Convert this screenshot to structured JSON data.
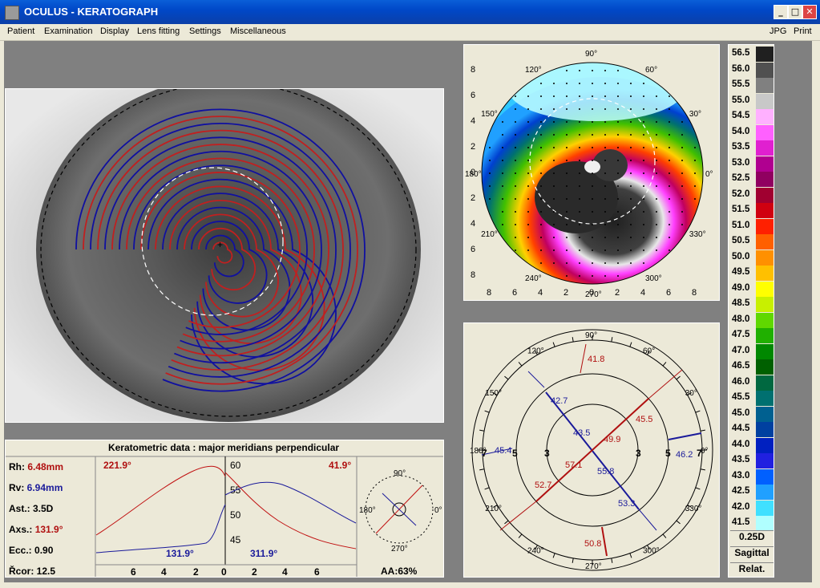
{
  "window": {
    "title": "OCULUS  -  KERATOGRAPH",
    "min": "_",
    "max": "□",
    "close": "✕"
  },
  "menu": {
    "items": [
      "Patient",
      "Examination",
      "Display",
      "Lens fitting",
      "Settings",
      "Miscellaneous"
    ],
    "right": [
      "JPG",
      "Print"
    ]
  },
  "topo_map": {
    "angle_labels": [
      "90°",
      "60°",
      "30°",
      "0°",
      "330°",
      "300°",
      "270°",
      "240°",
      "210°",
      "180°",
      "150°",
      "120°"
    ],
    "y_ticks": [
      "8",
      "6",
      "4",
      "2",
      "0",
      "2",
      "4",
      "6",
      "8"
    ],
    "x_ticks": [
      "8",
      "6",
      "4",
      "2",
      "0",
      "2",
      "4",
      "6",
      "8"
    ]
  },
  "polar": {
    "angle_labels": [
      "90°",
      "60°",
      "30°",
      "0°",
      "330°",
      "300°",
      "270°",
      "240°",
      "210°",
      "180°",
      "150°",
      "120°"
    ],
    "ring_labels": [
      "3",
      "5",
      "7",
      "3",
      "5",
      "7"
    ],
    "values": [
      {
        "text": "41.8",
        "color": "red"
      },
      {
        "text": "42.7",
        "color": "blue"
      },
      {
        "text": "45.5",
        "color": "red"
      },
      {
        "text": "43.5",
        "color": "blue"
      },
      {
        "text": "49.9",
        "color": "red"
      },
      {
        "text": "45.4",
        "color": "blue"
      },
      {
        "text": "46.2",
        "color": "blue"
      },
      {
        "text": "57.1",
        "color": "red"
      },
      {
        "text": "55.8",
        "color": "blue"
      },
      {
        "text": "52.7",
        "color": "red"
      },
      {
        "text": "53.3",
        "color": "blue"
      },
      {
        "text": "50.8",
        "color": "red"
      }
    ]
  },
  "kerato": {
    "title": "Keratometric data : major meridians perpendicular",
    "rows": [
      {
        "label": "Rh:",
        "value": "6.48mm",
        "color": "red"
      },
      {
        "label": "Rv:",
        "value": "6.94mm",
        "color": "blue"
      },
      {
        "label": "Ast.:",
        "value": "3.5D",
        "color": "black"
      },
      {
        "label": "Axs.:",
        "value": "131.9°",
        "color": "red"
      },
      {
        "label": "Ecc.:",
        "value": "0.90",
        "color": "black"
      },
      {
        "label": "Řcor:",
        "value": "12.5",
        "color": "black"
      }
    ],
    "left_red_angle": "221.9°",
    "left_blue_angle": "131.9°",
    "right_red_angle": "41.9°",
    "right_blue_angle": "311.9°",
    "y_ticks": [
      "60",
      "55",
      "50",
      "45"
    ],
    "x_ticks": [
      "6",
      "4",
      "2",
      "0",
      "2",
      "4",
      "6"
    ],
    "mini_angles": [
      "90°",
      "0°",
      "270°",
      "180°"
    ],
    "aa": "AA:63%"
  },
  "legend": {
    "scale": [
      {
        "v": "56.5",
        "c": "#202020"
      },
      {
        "v": "56.0",
        "c": "#505050"
      },
      {
        "v": "55.5",
        "c": "#808080"
      },
      {
        "v": "55.0",
        "c": "#c8c8c8"
      },
      {
        "v": "54.5",
        "c": "#ffb0ff"
      },
      {
        "v": "54.0",
        "c": "#ff60ff"
      },
      {
        "v": "53.5",
        "c": "#e020d0"
      },
      {
        "v": "53.0",
        "c": "#b00090"
      },
      {
        "v": "52.5",
        "c": "#900060"
      },
      {
        "v": "52.0",
        "c": "#a00030"
      },
      {
        "v": "51.5",
        "c": "#d00010"
      },
      {
        "v": "51.0",
        "c": "#ff2000"
      },
      {
        "v": "50.5",
        "c": "#ff6000"
      },
      {
        "v": "50.0",
        "c": "#ff9000"
      },
      {
        "v": "49.5",
        "c": "#ffc000"
      },
      {
        "v": "49.0",
        "c": "#ffff00"
      },
      {
        "v": "48.5",
        "c": "#c8f000"
      },
      {
        "v": "48.0",
        "c": "#60d800"
      },
      {
        "v": "47.5",
        "c": "#20b000"
      },
      {
        "v": "47.0",
        "c": "#008800"
      },
      {
        "v": "46.5",
        "c": "#006000"
      },
      {
        "v": "46.0",
        "c": "#006840"
      },
      {
        "v": "45.5",
        "c": "#007070"
      },
      {
        "v": "45.0",
        "c": "#006090"
      },
      {
        "v": "44.5",
        "c": "#0040a0"
      },
      {
        "v": "44.0",
        "c": "#0020c0"
      },
      {
        "v": "43.5",
        "c": "#2020e0"
      },
      {
        "v": "43.0",
        "c": "#0060ff"
      },
      {
        "v": "42.5",
        "c": "#20a0ff"
      },
      {
        "v": "42.0",
        "c": "#40e0ff"
      },
      {
        "v": "41.5",
        "c": "#b0ffff"
      }
    ],
    "step": "0.25D",
    "mode": "Sagittal",
    "relative": "Relat."
  }
}
